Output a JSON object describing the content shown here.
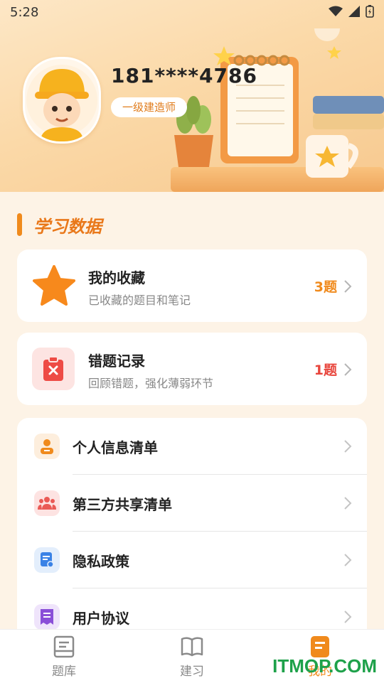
{
  "status_bar": {
    "time": "5:28"
  },
  "profile": {
    "phone": "181****4786",
    "level": "一级建造师"
  },
  "section": {
    "title": "学习数据"
  },
  "favorites": {
    "title": "我的收藏",
    "subtitle": "已收藏的题目和笔记",
    "count": "3题",
    "count_color": "#f08a1c"
  },
  "mistakes": {
    "title": "错题记录",
    "subtitle": "回顾错题，强化薄弱环节",
    "count": "1题",
    "count_color": "#e8453c"
  },
  "menu": {
    "items": [
      {
        "label": "个人信息清单",
        "icon": "person-icon"
      },
      {
        "label": "第三方共享清单",
        "icon": "group-icon"
      },
      {
        "label": "隐私政策",
        "icon": "document-icon"
      },
      {
        "label": "用户协议",
        "icon": "agreement-icon"
      }
    ]
  },
  "bottom_nav": {
    "items": [
      {
        "label": "题库",
        "icon": "question-bank-icon"
      },
      {
        "label": "建习",
        "icon": "book-icon"
      },
      {
        "label": "我的",
        "icon": "profile-icon",
        "active": true
      }
    ]
  },
  "watermark": "ITMOP.COM",
  "colors": {
    "accent": "#f08a1c",
    "danger": "#e8453c",
    "background": "#fdf3e6"
  }
}
